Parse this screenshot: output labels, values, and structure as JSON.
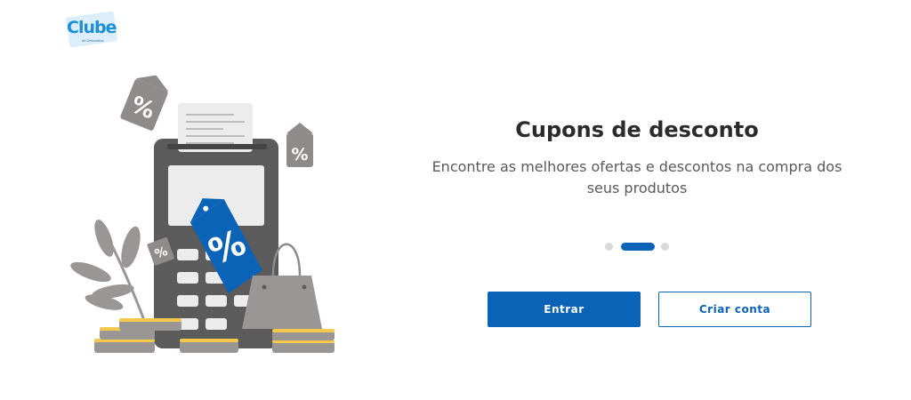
{
  "brand": {
    "logo_text": "Clube",
    "logo_subtext": "de Descontos"
  },
  "onboarding": {
    "title": "Cupons de desconto",
    "subtitle": "Encontre as melhores ofertas e descontos na compra dos seus produtos",
    "slides_total": 3,
    "active_slide": 2
  },
  "buttons": {
    "login_label": "Entrar",
    "signup_label": "Criar conta"
  },
  "colors": {
    "primary": "#0a63b6",
    "logo": "#1c8fd6",
    "coin": "#f2c94c",
    "tag_gray": "#8f8b8b"
  },
  "illustration": {
    "tag_symbol": "%"
  }
}
